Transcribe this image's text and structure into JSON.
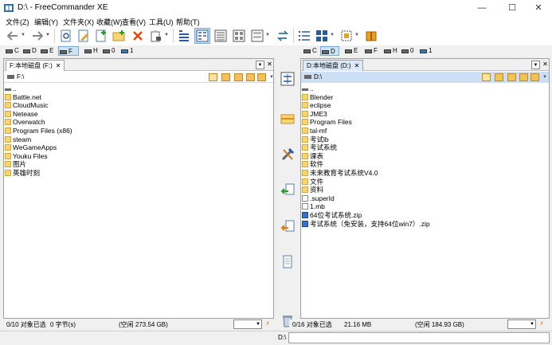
{
  "window": {
    "title": "D:\\ - FreeCommander XE",
    "minimize": "—",
    "maximize": "☐",
    "close": "✕"
  },
  "menu": [
    "文件(Z)",
    "编辑(Y)",
    "文件夹(X)",
    "收藏(W)",
    "查看(V)",
    "工具(U)",
    "帮助(T)"
  ],
  "drives": [
    "C",
    "D",
    "E",
    "F",
    "H",
    "0",
    "1"
  ],
  "left": {
    "tab": "F:本地磁盘 (F:)",
    "path": "F:\\",
    "items": [
      {
        "name": "..",
        "type": "parent"
      },
      {
        "name": "Battle.net",
        "type": "folder"
      },
      {
        "name": "CloudMusic",
        "type": "folder"
      },
      {
        "name": "Netease",
        "type": "folder"
      },
      {
        "name": "Overwatch",
        "type": "folder"
      },
      {
        "name": "Program Files (x86)",
        "type": "folder"
      },
      {
        "name": "steam",
        "type": "folder"
      },
      {
        "name": "WeGameApps",
        "type": "folder"
      },
      {
        "name": "Youku Files",
        "type": "folder"
      },
      {
        "name": "图片",
        "type": "folder"
      },
      {
        "name": "英雄时刻",
        "type": "folder"
      }
    ],
    "status": {
      "selection": "0/10 对象已选",
      "bytes": "0 字节(s)",
      "free": "(空闲 273.54 GB)"
    }
  },
  "right": {
    "tab": "D:本地磁盘 (D:)",
    "path": "D:\\",
    "items": [
      {
        "name": "..",
        "type": "parent"
      },
      {
        "name": "Blender",
        "type": "folder"
      },
      {
        "name": "eclipse",
        "type": "folder"
      },
      {
        "name": "JME3",
        "type": "folder"
      },
      {
        "name": "Program Files",
        "type": "folder"
      },
      {
        "name": "tal-mf",
        "type": "folder"
      },
      {
        "name": "考试lb",
        "type": "folder"
      },
      {
        "name": "考试系统",
        "type": "folder"
      },
      {
        "name": "课表",
        "type": "folder"
      },
      {
        "name": "软件",
        "type": "folder"
      },
      {
        "name": "未来教育考试系统V4.0",
        "type": "folder"
      },
      {
        "name": "文件",
        "type": "folder"
      },
      {
        "name": "资料",
        "type": "folder"
      },
      {
        "name": ".superId",
        "type": "file"
      },
      {
        "name": "1.mb",
        "type": "file"
      },
      {
        "name": "64位考试系统.zip",
        "type": "zip"
      },
      {
        "name": "考试系统（免安装，支持64位win7）.zip",
        "type": "zip"
      }
    ],
    "status": {
      "selection": "0/16 对象已选",
      "bytes": "21.16 MB",
      "free": "(空闲 184.93 GB)"
    }
  },
  "cmdline": {
    "label": "D:\\",
    "value": ""
  },
  "colors": {
    "accent": "#cde4f7",
    "folder": "#f7d56f",
    "active_path": "#cce0f5"
  }
}
